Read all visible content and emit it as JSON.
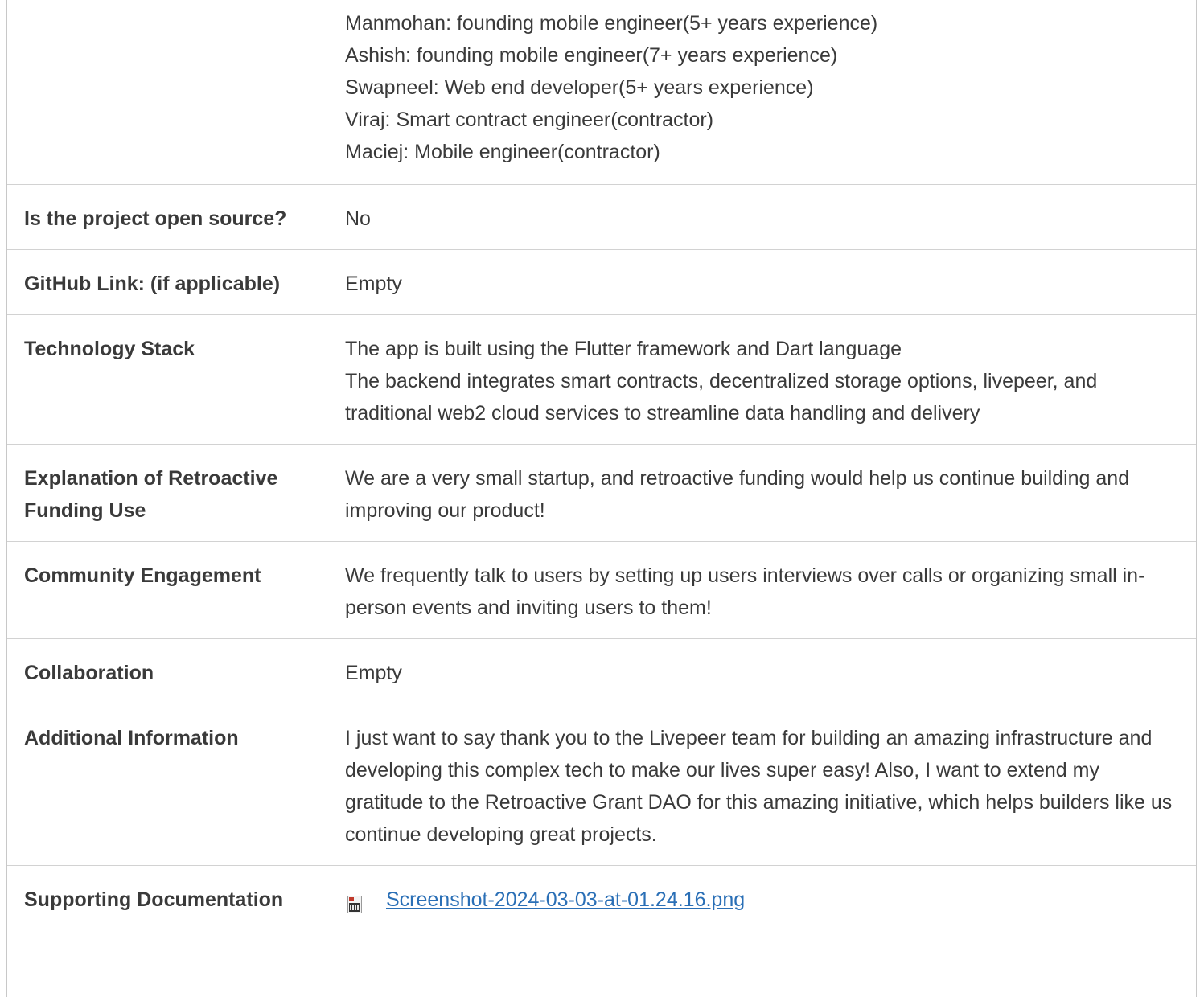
{
  "rows": [
    {
      "label": "",
      "lines": [
        "Manmohan: founding mobile engineer(5+ years experience)",
        "Ashish: founding mobile engineer(7+ years experience)",
        "Swapneel: Web end developer(5+ years experience)",
        "Viraj: Smart contract engineer(contractor)",
        "Maciej: Mobile engineer(contractor)"
      ]
    },
    {
      "label": "Is the project open source?",
      "value": "No"
    },
    {
      "label": "GitHub Link: (if applicable)",
      "value": "Empty"
    },
    {
      "label": "Technology Stack",
      "lines": [
        "The app is built using the Flutter framework and Dart language",
        "The backend integrates smart contracts, decentralized storage options, livepeer, and traditional web2 cloud services to streamline data handling and delivery"
      ]
    },
    {
      "label": "Explanation of Retroactive Funding Use",
      "value": "We are a very small startup, and retroactive funding would help us continue building and improving our product!"
    },
    {
      "label": "Community Engagement",
      "value": "We frequently talk to users by setting up users interviews over calls or organizing small in-person events and inviting users to them!"
    },
    {
      "label": "Collaboration",
      "value": "Empty"
    },
    {
      "label": "Additional Information",
      "value": "I just want to say thank you to the Livepeer team for building an amazing infrastructure and developing this complex tech to make our lives super easy! Also, I want to extend my gratitude to the Retroactive Grant DAO for this amazing initiative, which helps builders like us continue developing great projects."
    },
    {
      "label": "Supporting Documentation",
      "file": {
        "name": "Screenshot-2024-03-03-at-01.24.16.png",
        "icon": "image-file-icon"
      }
    }
  ],
  "colors": {
    "text": "#3a3a3a",
    "link": "#2a6fb6",
    "border": "#d2d2d2"
  }
}
